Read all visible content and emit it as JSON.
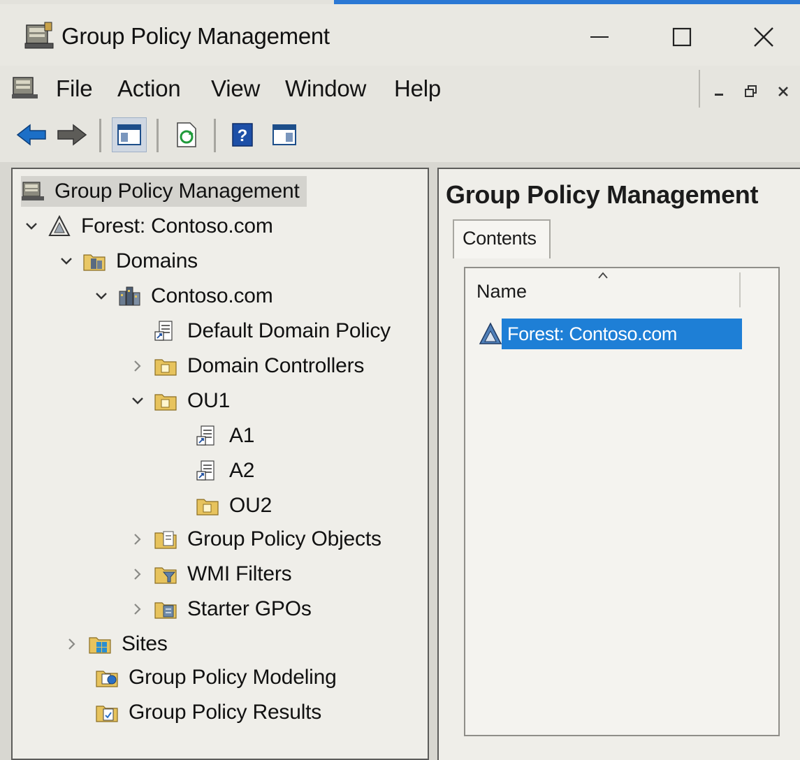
{
  "window": {
    "title": "Group Policy Management",
    "controls": {
      "minimize": "minimize",
      "maximize": "maximize",
      "close": "close"
    }
  },
  "menubar": {
    "items": [
      {
        "label": "File"
      },
      {
        "label": "Action"
      },
      {
        "label": "View"
      },
      {
        "label": "Window"
      },
      {
        "label": "Help"
      }
    ]
  },
  "toolbar": {
    "buttons": [
      "back-arrow-icon",
      "forward-arrow-icon",
      "show-hide-tree-icon",
      "refresh-icon",
      "help-icon",
      "action-pane-icon"
    ]
  },
  "tree": {
    "root": "Group Policy Management",
    "forest": "Forest: Contoso.com",
    "domains": "Domains",
    "domain": "Contoso.com",
    "default_policy": "Default Domain Policy",
    "domain_controllers": "Domain Controllers",
    "ou1": "OU1",
    "a1": "A1",
    "a2": "A2",
    "ou2": "OU2",
    "gpo": "Group Policy Objects",
    "wmi": "WMI Filters",
    "starter": "Starter GPOs",
    "sites": "Sites",
    "modeling": "Group Policy Modeling",
    "results": "Group Policy Results"
  },
  "details": {
    "title": "Group Policy Management",
    "tab": "Contents",
    "column_name": "Name",
    "rows": [
      {
        "name": "Forest: Contoso.com",
        "selected": true
      }
    ]
  },
  "colors": {
    "selection": "#1e7fd6",
    "title_accent": "#2b78d4"
  }
}
